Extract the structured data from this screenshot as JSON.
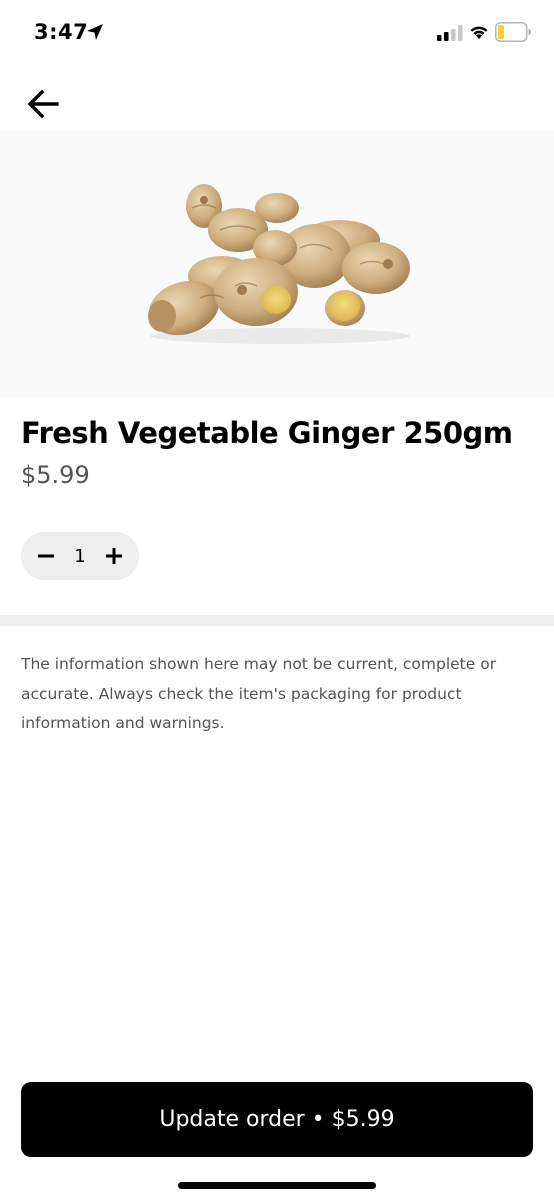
{
  "status_bar": {
    "time": "3:47",
    "icons": [
      "location-arrow-icon",
      "signal-icon",
      "wifi-icon",
      "battery-icon"
    ],
    "battery_color": "#f4d42e"
  },
  "nav": {
    "back_icon": "arrow-left-icon"
  },
  "product": {
    "image": "ginger-root-image",
    "title": "Fresh Vegetable Ginger 250gm",
    "price": "$5.99"
  },
  "stepper": {
    "quantity": "1",
    "decrement_icon": "minus-icon",
    "increment_icon": "plus-icon"
  },
  "disclaimer": "The information shown here may not be current, complete or accurate.  Always check the item's packaging for product information and warnings.",
  "cta": {
    "label": "Update order • $5.99"
  },
  "colors": {
    "primary": "#000000",
    "secondary_text": "#545454",
    "surface": "#eeeeee",
    "image_bg": "#fafafa"
  }
}
